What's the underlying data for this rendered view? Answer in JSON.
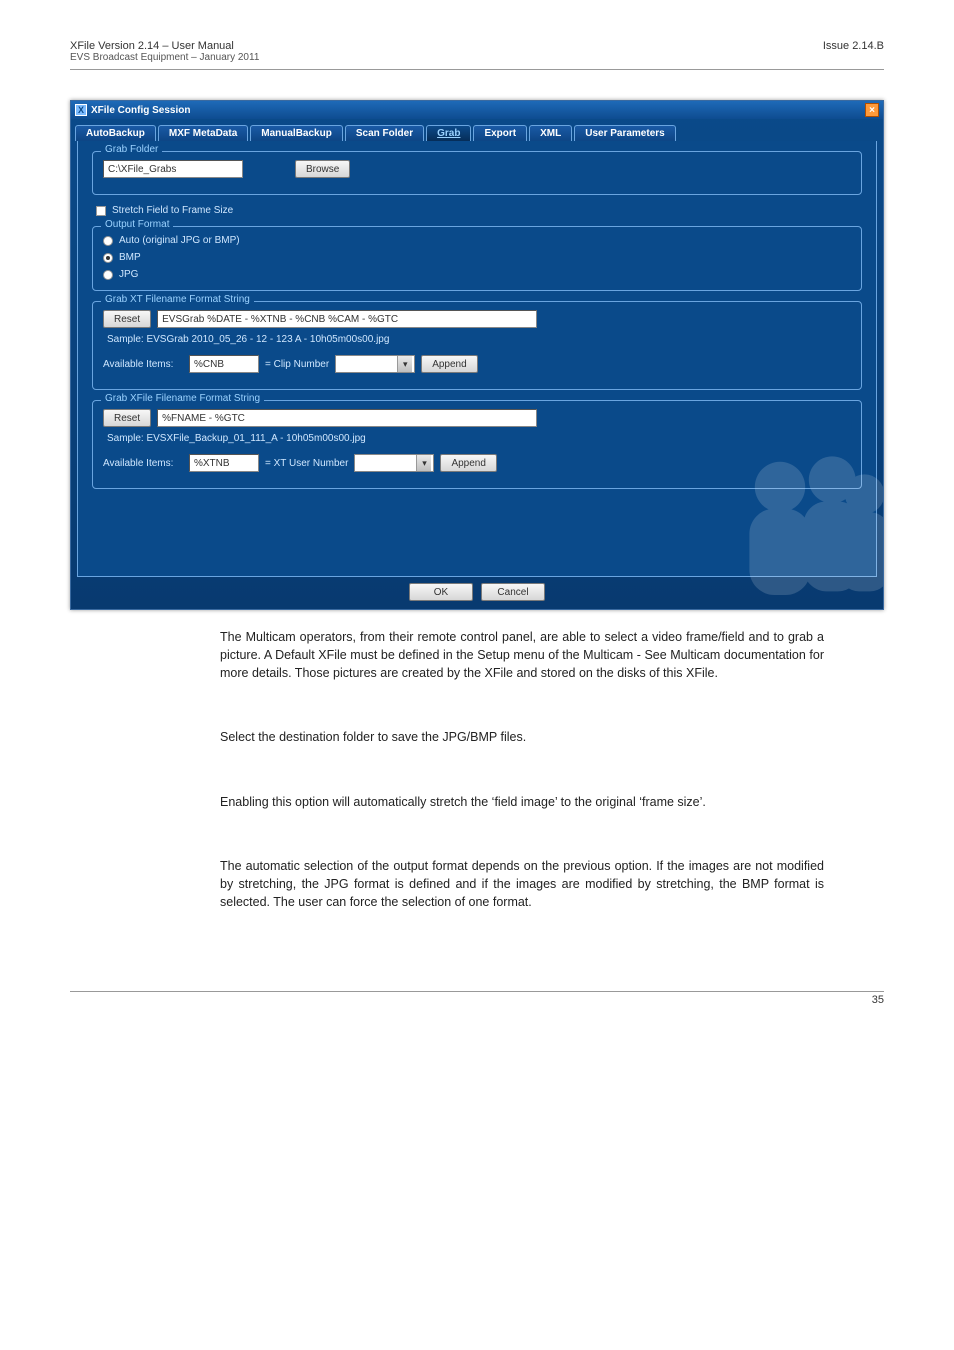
{
  "header": {
    "product_line": "XFile Version 2.14 – User Manual",
    "vendor_line": "EVS Broadcast Equipment – January 2011",
    "issue": "Issue 2.14.B"
  },
  "window": {
    "title": "XFile Config Session"
  },
  "tabs": {
    "items": [
      "AutoBackup",
      "MXF MetaData",
      "ManualBackup",
      "Scan Folder",
      "Grab",
      "Export",
      "XML",
      "User Parameters"
    ],
    "active_index": 4
  },
  "grab": {
    "folder_group_legend": "Grab Folder",
    "folder_value": "C:\\XFile_Grabs",
    "browse_label": "Browse",
    "stretch_label": "Stretch Field to Frame Size",
    "format_group_legend": "Output Format",
    "format_options": [
      "Auto (original JPG or BMP)",
      "BMP",
      "JPG"
    ],
    "format_selected": 1,
    "xt_group_legend": "Grab XT Filename Format String",
    "xt_reset": "Reset",
    "xt_value": "EVSGrab %DATE - %XTNB - %CNB %CAM - %GTC",
    "xt_sample": "Sample: EVSGrab 2010_05_26 - 12 - 123 A - 10h05m00s00.jpg",
    "xt_available": "Available Items:",
    "xt_dropdown_value": "%CNB",
    "xt_dropdown_desc": "= Clip Number",
    "xt_append": "Append",
    "xf_group_legend": "Grab XFile Filename Format String",
    "xf_reset": "Reset",
    "xf_value": "%FNAME - %GTC",
    "xf_sample": "Sample: EVSXFile_Backup_01_111_A - 10h05m00s00.jpg",
    "xf_available": "Available Items:",
    "xf_dropdown_value": "%XTNB",
    "xf_dropdown_desc": "= XT User Number",
    "xf_append": "Append"
  },
  "footer_buttons": {
    "ok": "OK",
    "cancel": "Cancel"
  },
  "body": {
    "para1": "The Multicam operators, from their remote control panel, are able to select a video frame/field and to grab a picture. A Default XFile must be defined in the Setup menu of the Multicam - See Multicam documentation for more details. Those pictures are created by the XFile and stored on the disks of this XFile.",
    "para2": "Select the destination folder to save the JPG/BMP files.",
    "para3": "Enabling this option will automatically stretch the ‘field image’ to the original ‘frame size’.",
    "para4": "The automatic selection of the output format depends on the previous option. If the images are not modified by stretching, the JPG format is defined and if the images are modified by stretching, the BMP format is selected. The user can force the selection of one format."
  },
  "page_number": "35"
}
